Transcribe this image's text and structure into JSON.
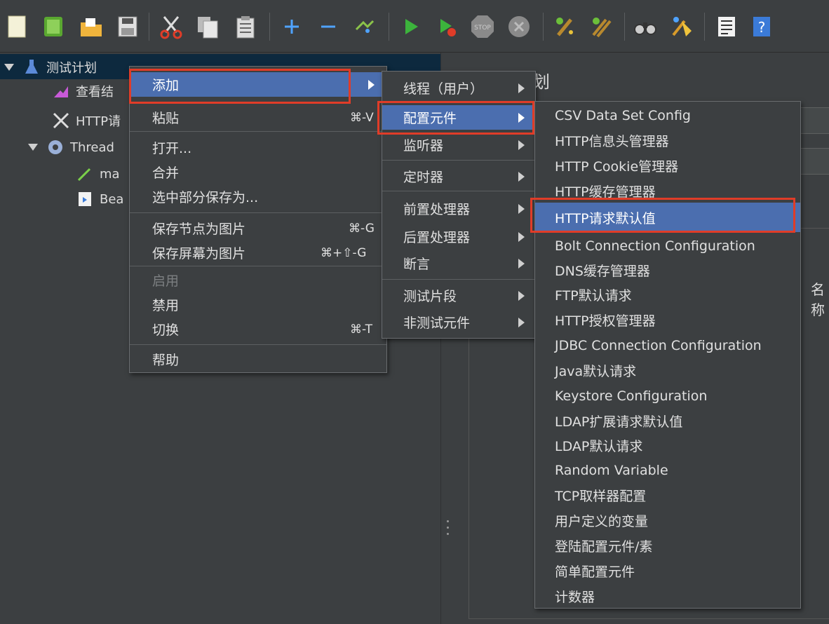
{
  "toolbar": {
    "icons": [
      "new-icon",
      "templates-icon",
      "open-icon",
      "save-icon",
      "cut-icon",
      "copy-icon",
      "paste-icon",
      "expand-icon",
      "collapse-icon",
      "toggle-icon",
      "start-icon",
      "start-no-pause-icon",
      "stop-icon",
      "shutdown-icon",
      "clear-icon",
      "clear-all-icon",
      "search-icon",
      "reset-search-icon",
      "function-helper-icon",
      "help-icon"
    ],
    "stop_label": "STOP"
  },
  "tree": {
    "items": [
      {
        "label": "测试计划"
      },
      {
        "label": "查看结"
      },
      {
        "label": "HTTP请"
      },
      {
        "label": "Thread"
      },
      {
        "label": "ma"
      },
      {
        "label": "Bea"
      }
    ]
  },
  "right_panel": {
    "title": "划",
    "column_header": "名称"
  },
  "menu1": {
    "items": [
      {
        "label": "添加",
        "shortcut": ""
      },
      {
        "label": "粘贴",
        "shortcut": "⌘-V"
      },
      {
        "label": "打开...",
        "shortcut": ""
      },
      {
        "label": "合并",
        "shortcut": ""
      },
      {
        "label": "选中部分保存为...",
        "shortcut": ""
      },
      {
        "label": "保存节点为图片",
        "shortcut": "⌘-G"
      },
      {
        "label": "保存屏幕为图片",
        "shortcut": "⌘+⇧-G"
      },
      {
        "label": "启用",
        "shortcut": ""
      },
      {
        "label": "禁用",
        "shortcut": ""
      },
      {
        "label": "切换",
        "shortcut": "⌘-T"
      },
      {
        "label": "帮助",
        "shortcut": ""
      }
    ]
  },
  "menu2": {
    "items": [
      {
        "label": "线程（用户）"
      },
      {
        "label": "配置元件"
      },
      {
        "label": "监听器"
      },
      {
        "label": "定时器"
      },
      {
        "label": "前置处理器"
      },
      {
        "label": "后置处理器"
      },
      {
        "label": "断言"
      },
      {
        "label": "测试片段"
      },
      {
        "label": "非测试元件"
      }
    ]
  },
  "menu3": {
    "items": [
      {
        "label": "CSV Data Set Config"
      },
      {
        "label": "HTTP信息头管理器"
      },
      {
        "label": "HTTP Cookie管理器"
      },
      {
        "label": "HTTP缓存管理器"
      },
      {
        "label": "HTTP请求默认值"
      },
      {
        "label": "Bolt Connection Configuration"
      },
      {
        "label": "DNS缓存管理器"
      },
      {
        "label": "FTP默认请求"
      },
      {
        "label": "HTTP授权管理器"
      },
      {
        "label": "JDBC Connection Configuration"
      },
      {
        "label": "Java默认请求"
      },
      {
        "label": "Keystore Configuration"
      },
      {
        "label": "LDAP扩展请求默认值"
      },
      {
        "label": "LDAP默认请求"
      },
      {
        "label": "Random Variable"
      },
      {
        "label": "TCP取样器配置"
      },
      {
        "label": "用户定义的变量"
      },
      {
        "label": "登陆配置元件/素"
      },
      {
        "label": "简单配置元件"
      },
      {
        "label": "计数器"
      }
    ]
  },
  "colors": {
    "background": "#3c3f41",
    "menu_selection": "#4b6eaf",
    "highlight_box": "#e03c28",
    "text": "#e0e0e0"
  }
}
